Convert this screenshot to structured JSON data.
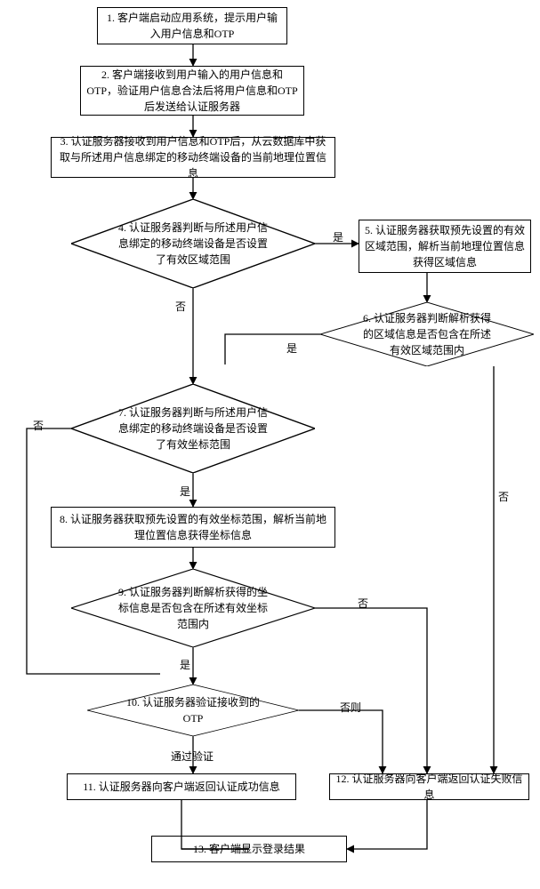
{
  "nodes": {
    "n1": "1. 客户端启动应用系统，提示用户输入用户信息和OTP",
    "n2": "2. 客户端接收到用户输入的用户信息和OTP，验证用户信息合法后将用户信息和OTP后发送给认证服务器",
    "n3": "3. 认证服务器接收到用户信息和OTP后，从云数据库中获取与所述用户信息绑定的移动终端设备的当前地理位置信息",
    "n4": "4. 认证服务器判断与所述用户信息绑定的移动终端设备是否设置了有效区域范围",
    "n5": "5. 认证服务器获取预先设置的有效区域范围，解析当前地理位置信息获得区域信息",
    "n6": "6. 认证服务器判断解析获得的区域信息是否包含在所述有效区域范围内",
    "n7": "7. 认证服务器判断与所述用户信息绑定的移动终端设备是否设置了有效坐标范围",
    "n8": "8. 认证服务器获取预先设置的有效坐标范围，解析当前地理位置信息获得坐标信息",
    "n9": "9. 认证服务器判断解析获得的坐标信息是否包含在所述有效坐标范围内",
    "n10": "10. 认证服务器验证接收到的OTP",
    "n11": "11. 认证服务器向客户端返回认证成功信息",
    "n12": "12. 认证服务器向客户端返回认证失败信息",
    "n13": "13. 客户端显示登录结果"
  },
  "labels": {
    "yes": "是",
    "no": "否",
    "else": "否则",
    "pass": "通过验证"
  }
}
